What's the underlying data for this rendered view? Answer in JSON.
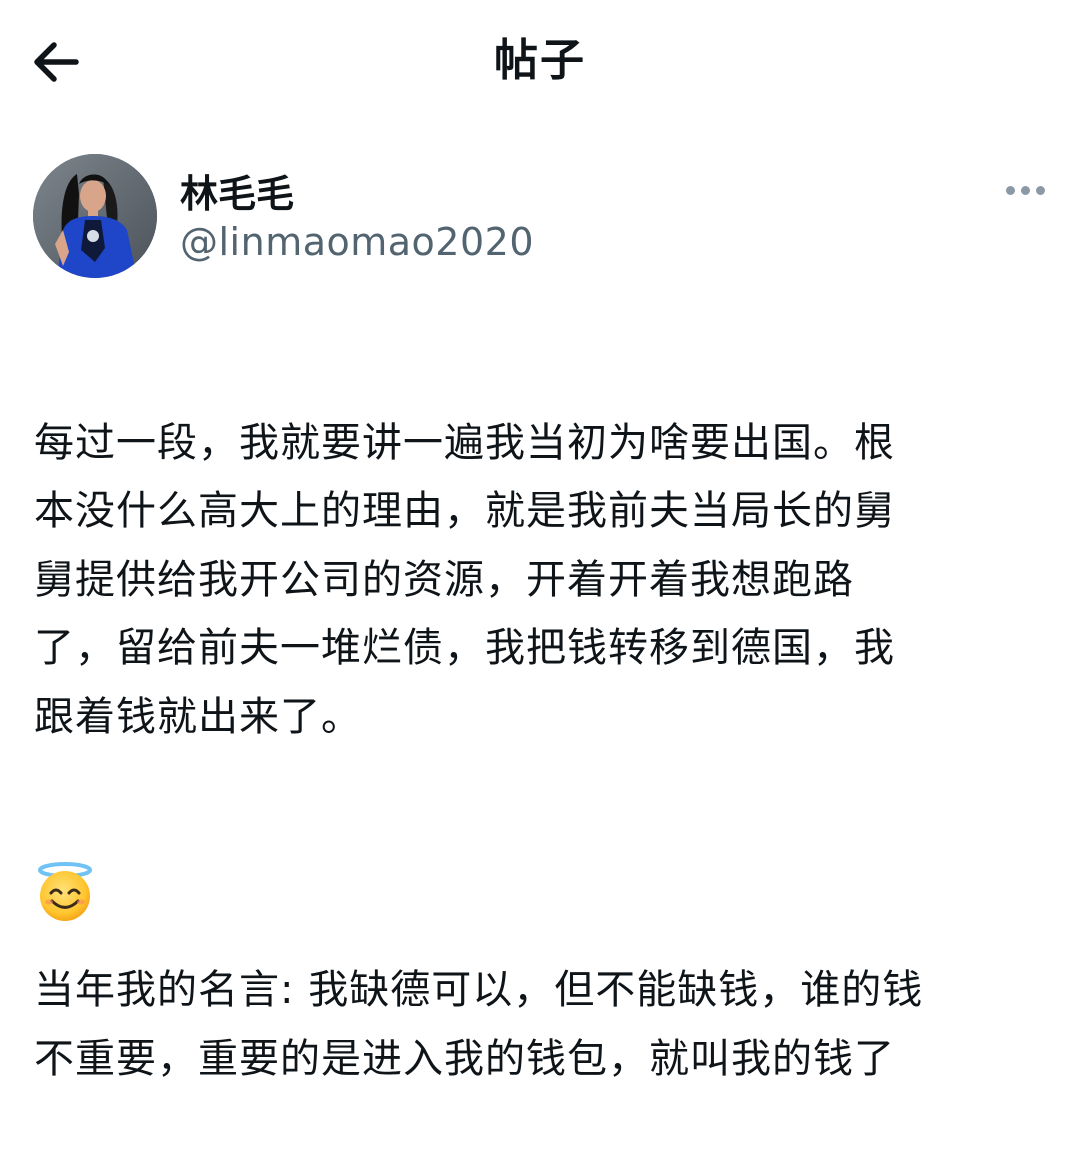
{
  "header": {
    "title": "帖子",
    "back_icon": "arrow-left-icon"
  },
  "author": {
    "display_name": "林毛毛",
    "handle": "@linmaomao2020",
    "avatar_icon": "user-avatar",
    "more_icon": "more-horizontal-icon"
  },
  "post": {
    "paragraph1": "每过一段，我就要讲一遍我当初为啥要出国。根\n本没什么高大上的理由，就是我前夫当局长的舅\n舅提供给我开公司的资源，开着开着我想跑路\n了，留给前夫一堆烂债，我把钱转移到德国，我\n跟着钱就出来了。",
    "paragraph2": "当年我的名言: 我缺德可以，但不能缺钱，谁的钱\n不重要，重要的是进入我的钱包，就叫我的钱了",
    "emoji_icon": "smiling-face-with-halo-icon"
  }
}
